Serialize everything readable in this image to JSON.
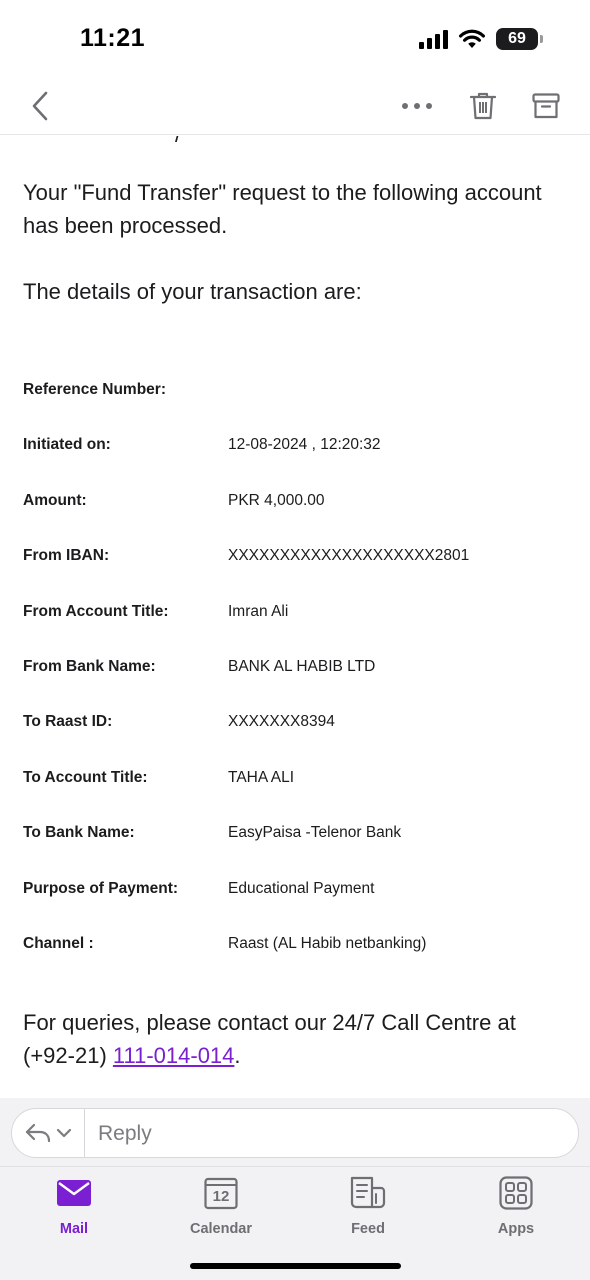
{
  "status_bar": {
    "time": "11:21",
    "battery": "69"
  },
  "nav": {
    "back_icon": "chevron-left-icon",
    "more_icon": "more-icon",
    "delete_icon": "trash-icon",
    "archive_icon": "archive-icon"
  },
  "email": {
    "partial_line": "/",
    "intro": "Your \"Fund Transfer\" request to the following account has been processed.",
    "details_heading": "The details of your transaction are:",
    "rows": [
      {
        "label": "Reference Number:",
        "value": ""
      },
      {
        "label": "Initiated on:",
        "value": "12-08-2024 , 12:20:32"
      },
      {
        "label": "Amount:",
        "value": "PKR 4,000.00"
      },
      {
        "label": "From IBAN:",
        "value": "XXXXXXXXXXXXXXXXXXXX2801"
      },
      {
        "label": "From Account Title:",
        "value": "Imran Ali"
      },
      {
        "label": "From Bank Name:",
        "value": "BANK AL HABIB LTD"
      },
      {
        "label": "To Raast ID:",
        "value": "XXXXXXX8394"
      },
      {
        "label": "To Account Title:",
        "value": "TAHA ALI"
      },
      {
        "label": "To Bank Name:",
        "value": "EasyPaisa -Telenor Bank"
      },
      {
        "label": "Purpose of Payment:",
        "value": "Educational Payment"
      },
      {
        "label": "Channel :",
        "value": "Raast (AL Habib netbanking)"
      }
    ],
    "queries_text": "For queries, please contact our 24/7 Call Centre at (+92-21) ",
    "phone": "111-014-014",
    "queries_end": "."
  },
  "reply": {
    "placeholder": "Reply"
  },
  "tabs": [
    {
      "label": "Mail",
      "icon": "mail-icon",
      "active": true
    },
    {
      "label": "Calendar",
      "icon": "calendar-icon",
      "day": "12",
      "active": false
    },
    {
      "label": "Feed",
      "icon": "feed-icon",
      "active": false
    },
    {
      "label": "Apps",
      "icon": "apps-icon",
      "active": false
    }
  ],
  "colors": {
    "accent": "#7a1fd1",
    "inactive": "#6e6e73"
  }
}
